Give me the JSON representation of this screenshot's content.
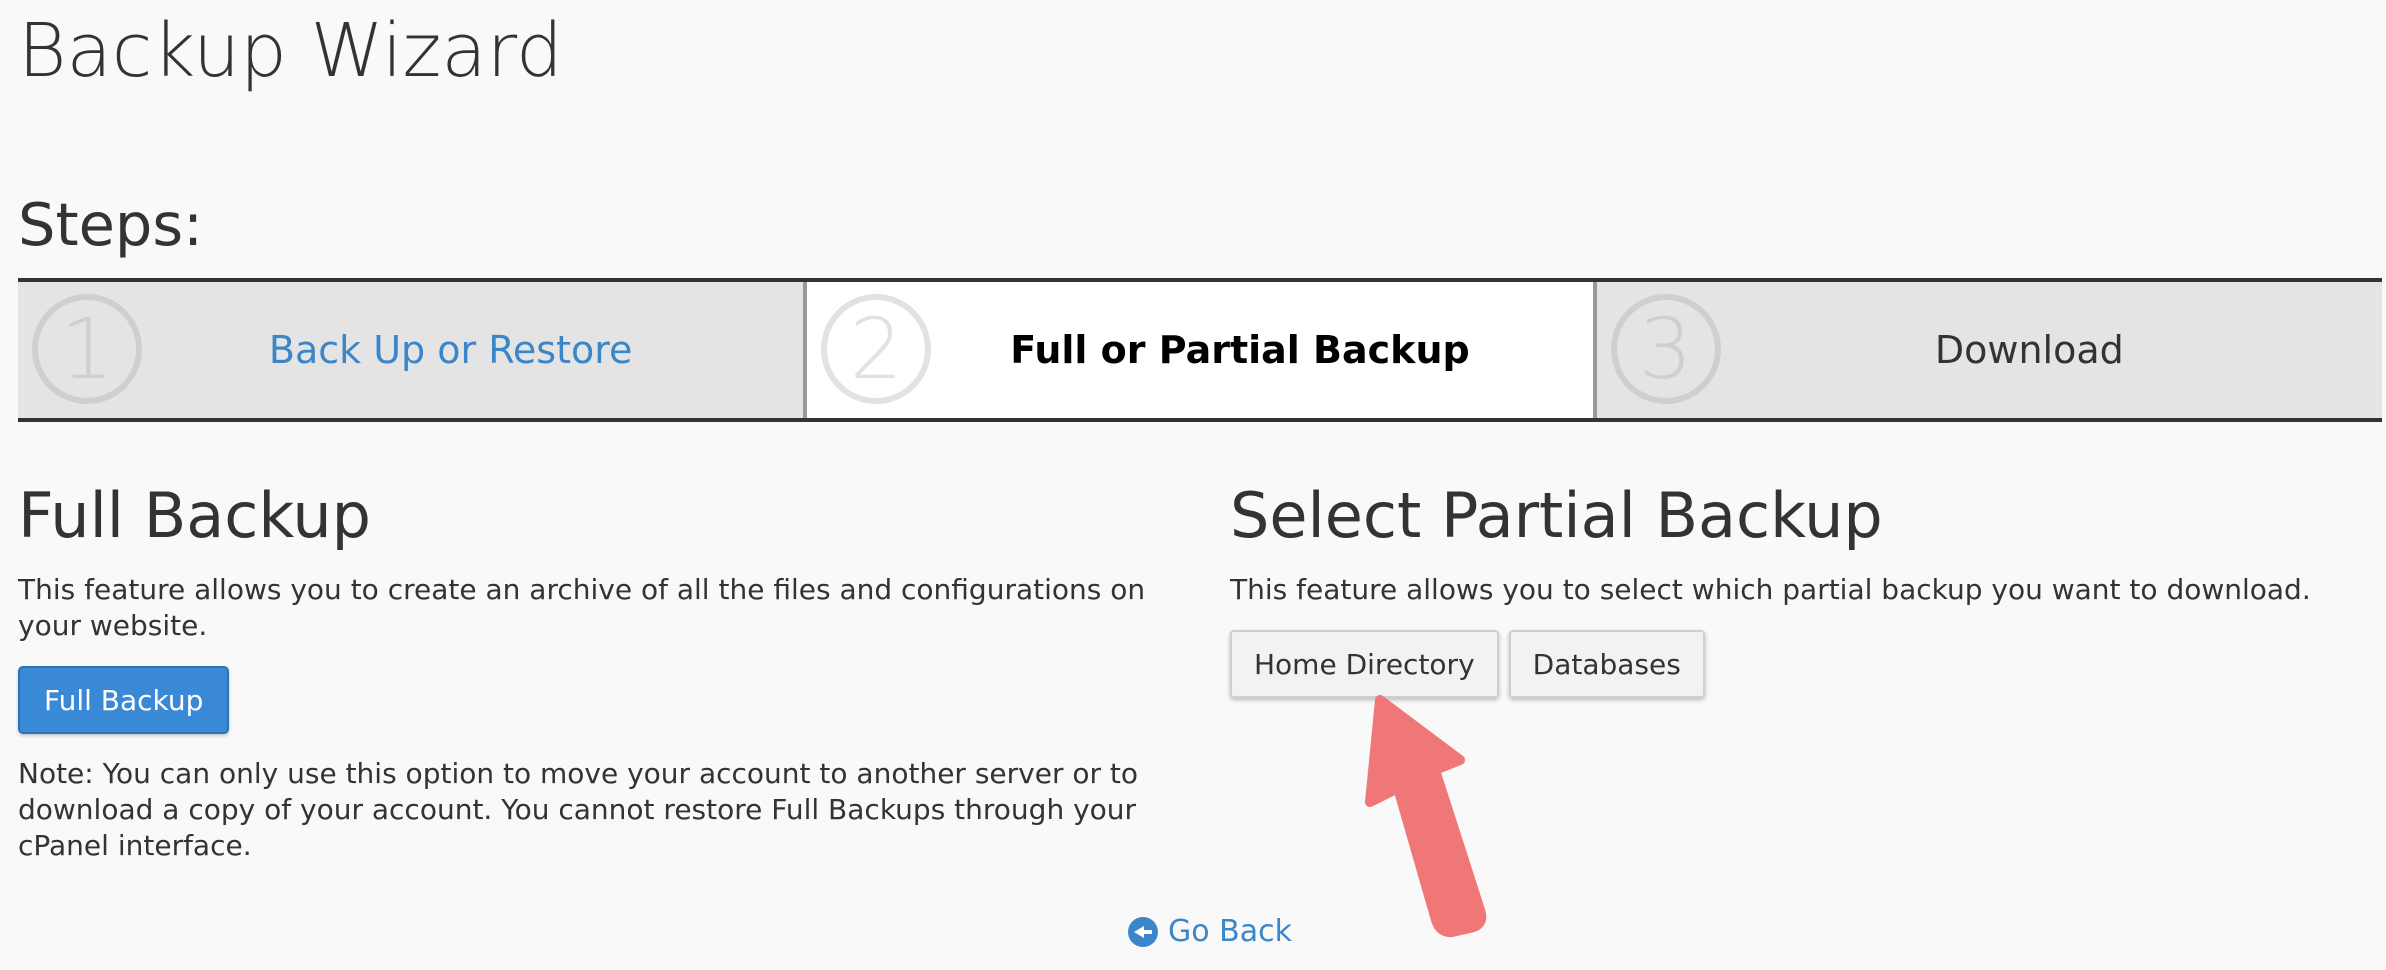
{
  "page_title": "Backup Wizard",
  "steps": {
    "heading": "Steps:",
    "items": [
      {
        "number": "1",
        "label": "Back Up or Restore"
      },
      {
        "number": "2",
        "label": "Full or Partial Backup"
      },
      {
        "number": "3",
        "label": "Download"
      }
    ]
  },
  "full_backup": {
    "title": "Full Backup",
    "description": "This feature allows you to create an archive of all the files and configurations on your website.",
    "button_label": "Full Backup",
    "note": "Note: You can only use this option to move your account to another server or to download a copy of your account. You cannot restore Full Backups through your cPanel interface."
  },
  "partial_backup": {
    "title": "Select Partial Backup",
    "description": "This feature allows you to select which partial backup you want to download.",
    "buttons": [
      "Home Directory",
      "Databases"
    ]
  },
  "go_back": {
    "label": "Go Back",
    "icon": "arrow-left-circle-icon"
  },
  "annotation": {
    "icon": "pointer-arrow-icon",
    "color": "#f07777"
  },
  "colors": {
    "link": "#3a86c8",
    "primary": "#3a89d6",
    "background": "#f9f9f9"
  }
}
